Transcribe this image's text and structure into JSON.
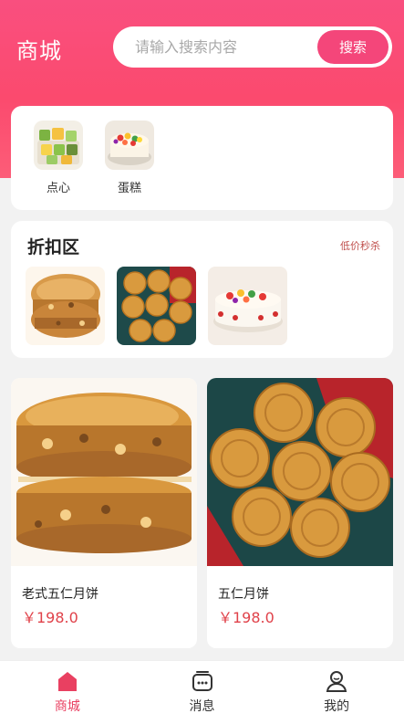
{
  "header": {
    "title": "商城",
    "search_placeholder": "请输入搜索内容",
    "search_button": "搜索",
    "accent_color": "#f94f7f"
  },
  "categories": [
    {
      "label": "点心",
      "icon": "dim-sum-thumbnail"
    },
    {
      "label": "蛋糕",
      "icon": "cake-thumbnail"
    }
  ],
  "discount": {
    "title": "折扣区",
    "link": "低价秒杀",
    "items": [
      "lava-mooncake-image",
      "mooncake-box-image",
      "fruit-cake-image"
    ]
  },
  "products": [
    {
      "name": "老式五仁月饼",
      "price": "￥198.0"
    },
    {
      "name": "五仁月饼",
      "price": "￥198.0"
    }
  ],
  "nav": {
    "items": [
      {
        "label": "商城",
        "active": true,
        "icon": "shop-home-icon"
      },
      {
        "label": "消息",
        "active": false,
        "icon": "message-icon"
      },
      {
        "label": "我的",
        "active": false,
        "icon": "profile-icon"
      }
    ]
  },
  "colors": {
    "price": "#e0424a",
    "nav_active": "#e94061",
    "link": "#c0504d"
  }
}
